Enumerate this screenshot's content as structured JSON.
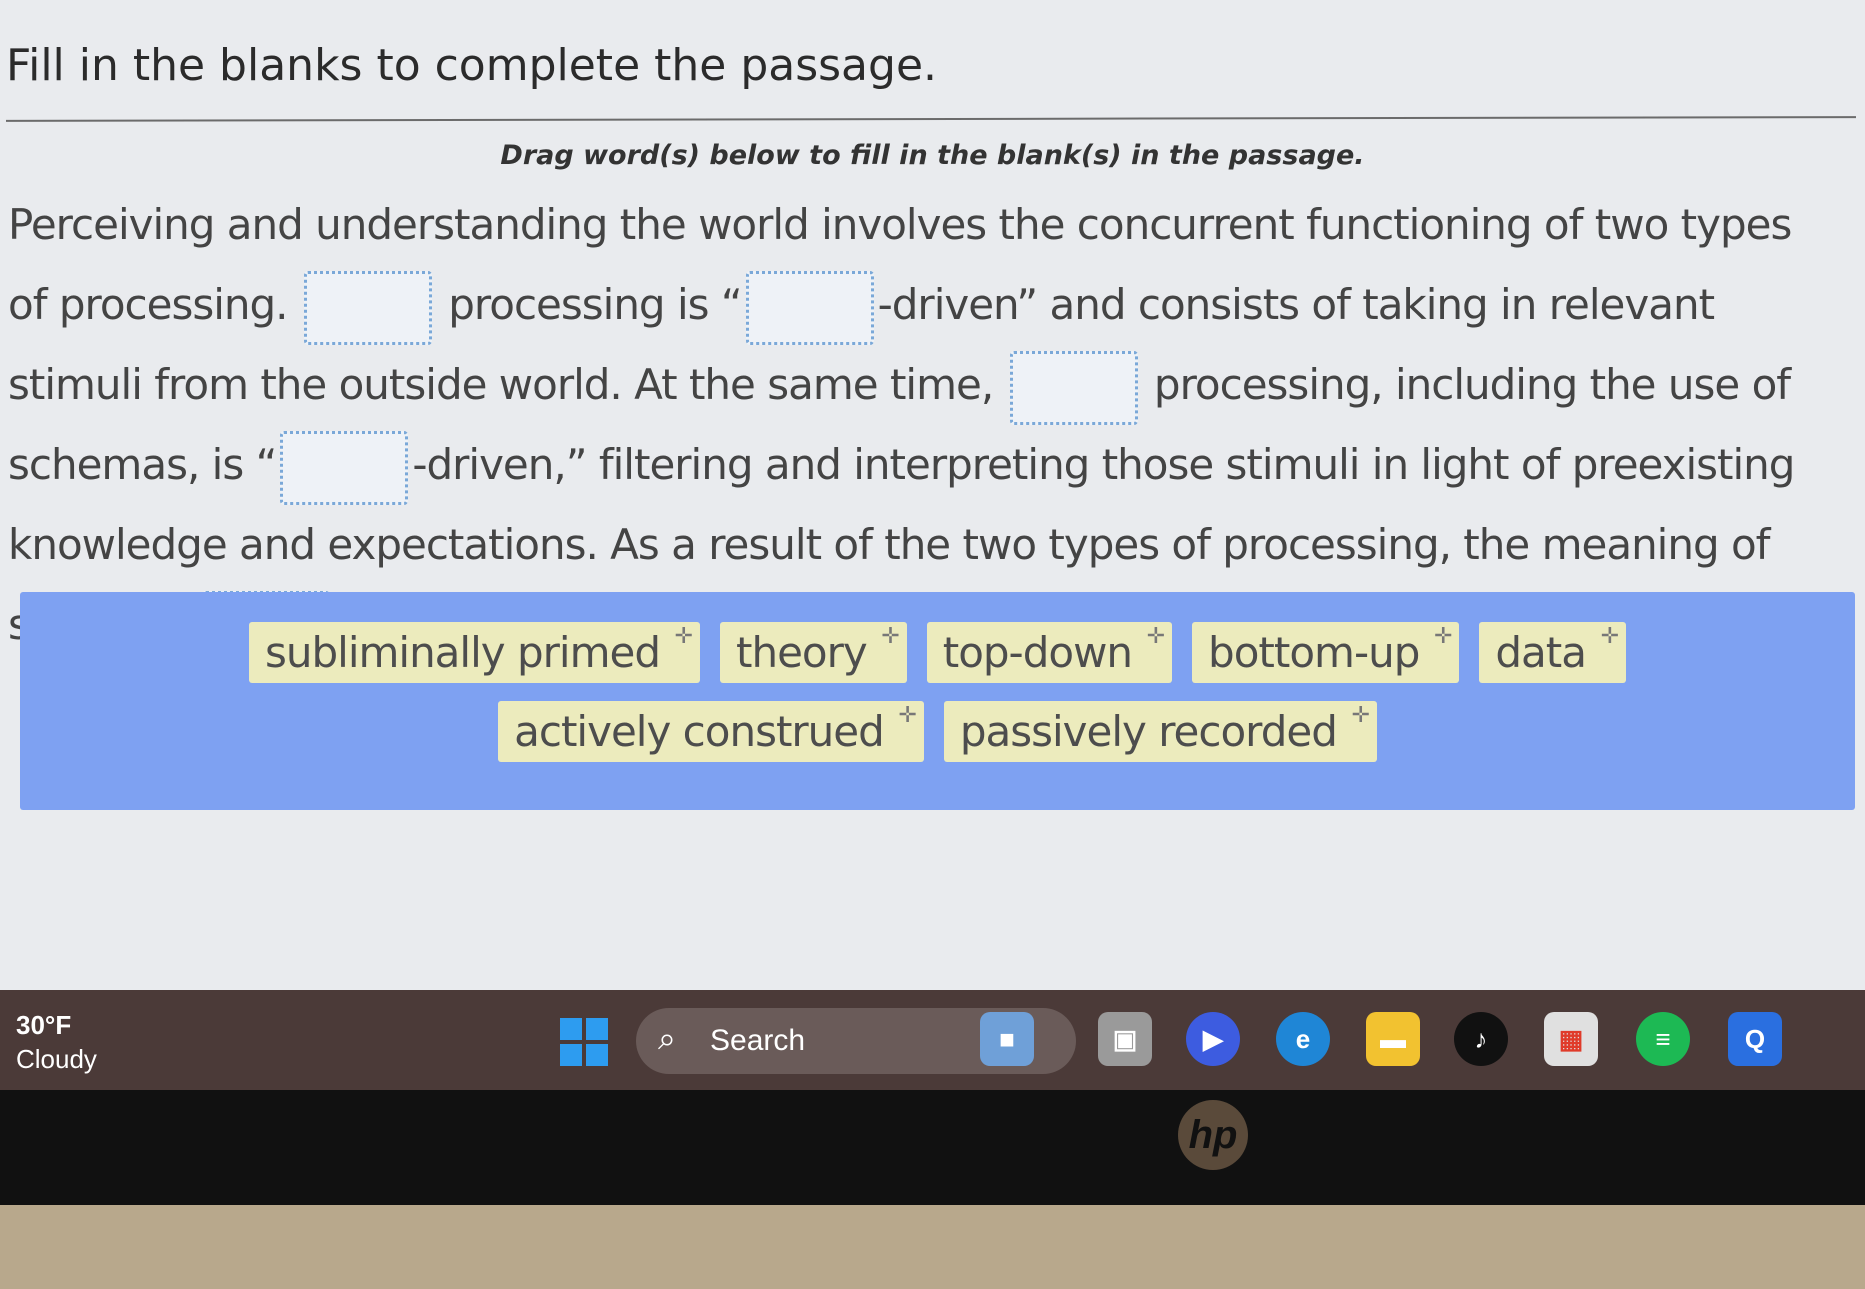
{
  "page": {
    "title": "Fill in the blanks to complete the passage.",
    "instruction": "Drag word(s) below to fill in the blank(s) in the passage."
  },
  "passage": {
    "t1": "Perceiving and understanding the world involves the concurrent functioning of two types of processing.",
    "t2": "processing is “",
    "t3": "-driven” and consists of taking in relevant stimuli from the outside world. At the same time,",
    "t4": "processing, including the use of schemas, is “",
    "t5": "-driven,” filtering and interpreting those stimuli in light of preexisting knowledge and expectations. As a result of the two types of processing, the meaning of stimuli is",
    "t6": "."
  },
  "word_bank": [
    "subliminally primed",
    "theory",
    "top-down",
    "bottom-up",
    "data",
    "actively construed",
    "passively recorded"
  ],
  "taskbar": {
    "temperature": "30°F",
    "condition": "Cloudy",
    "search_label": "Search",
    "apps": [
      "widgets-icon",
      "task-view-icon",
      "zoom-icon",
      "edge-icon",
      "file-explorer-icon",
      "tiktok-icon",
      "store-icon",
      "spotify-icon",
      "app-q-icon"
    ]
  },
  "device": {
    "brand": "hp"
  }
}
